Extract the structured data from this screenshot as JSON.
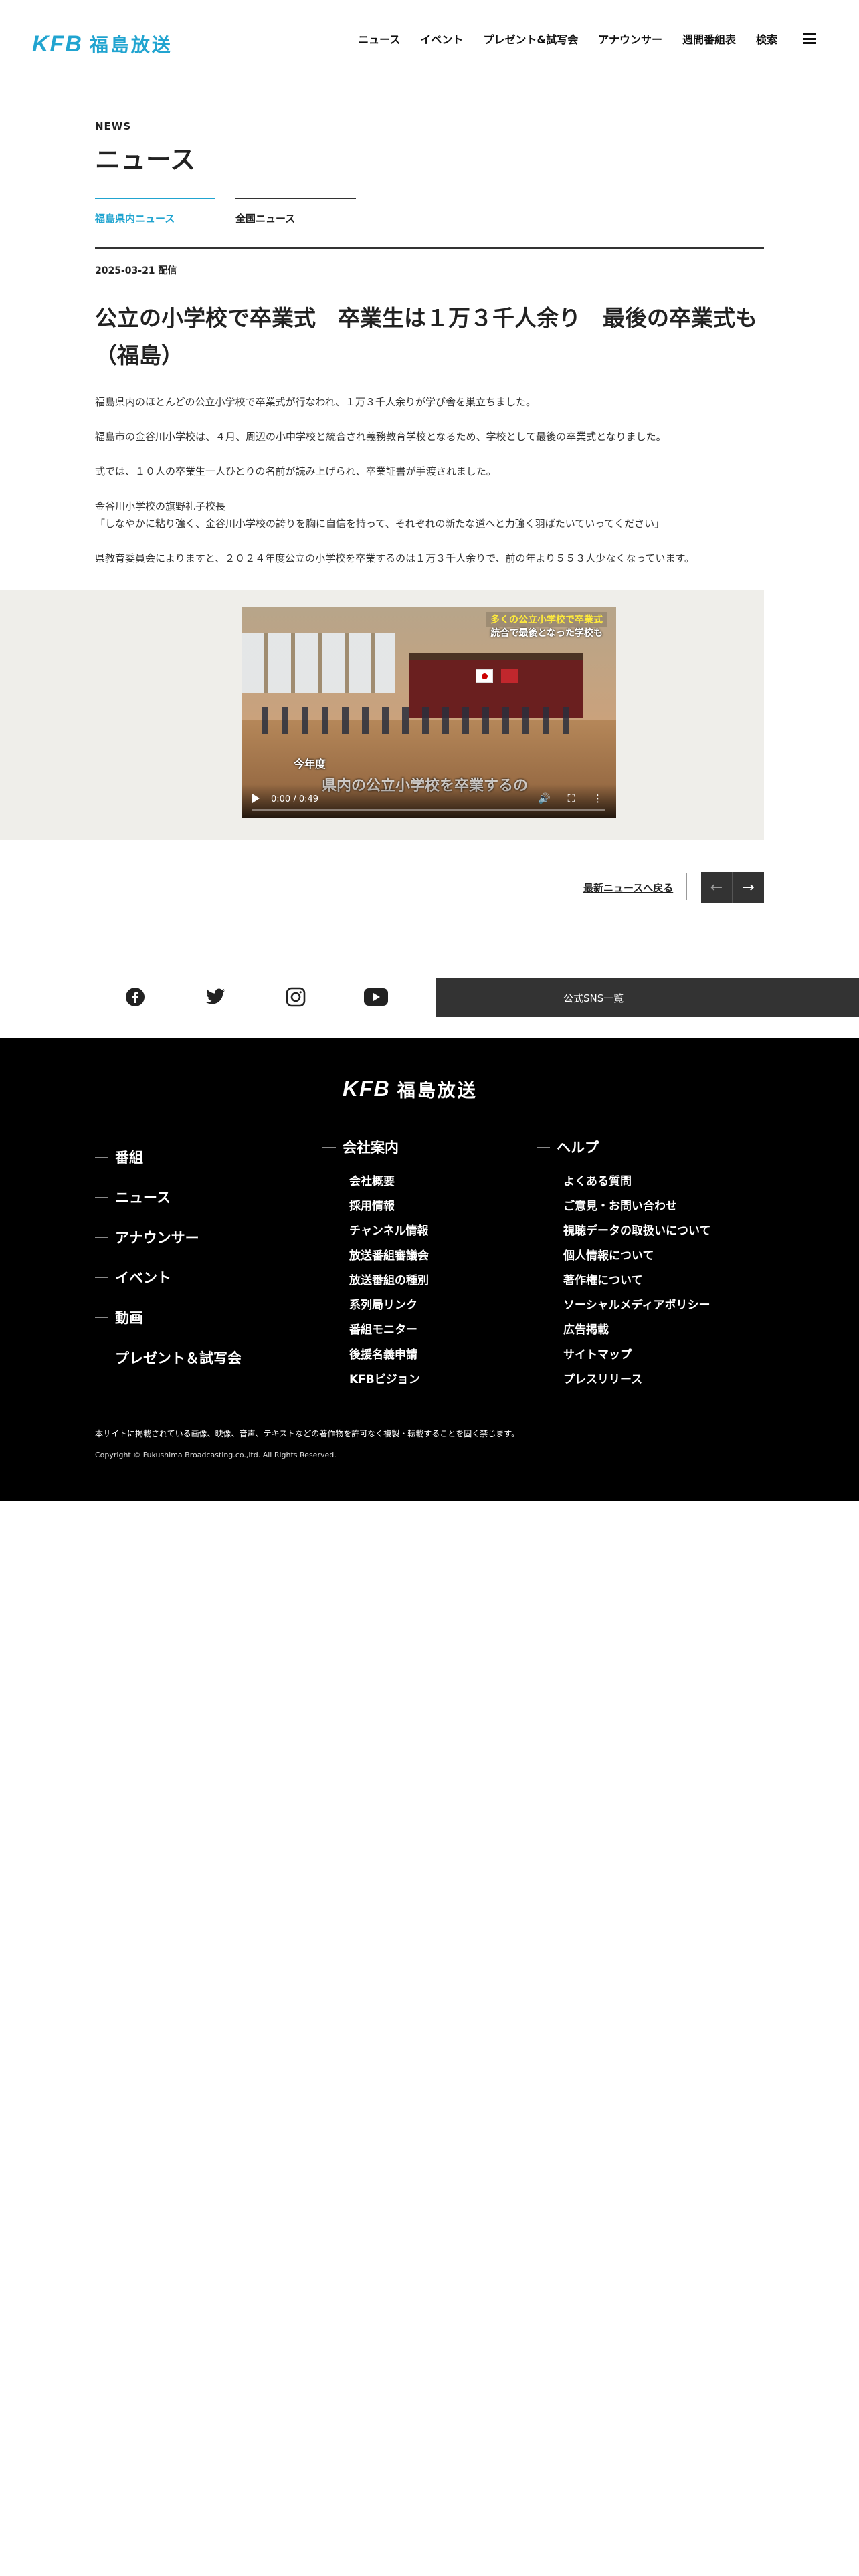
{
  "header": {
    "logo_mark": "KFB",
    "logo_text": "福島放送",
    "nav": [
      "ニュース",
      "イベント",
      "プレゼント&試写会",
      "アナウンサー",
      "週間番組表",
      "検索"
    ]
  },
  "page": {
    "eyebrow": "NEWS",
    "title": "ニュース",
    "tabs": [
      "福島県内ニュース",
      "全国ニュース"
    ]
  },
  "article": {
    "date": "2025-03-21 配信",
    "title": "公立の小学校で卒業式　卒業生は１万３千人余り　最後の卒業式も　（福島）",
    "paragraphs": [
      "福島県内のほとんどの公立小学校で卒業式が行なわれ、１万３千人余りが学び舎を巣立ちました。",
      "福島市の金谷川小学校は、４月、周辺の小中学校と統合され義務教育学校となるため、学校として最後の卒業式となりました。",
      "式では、１０人の卒業生一人ひとりの名前が読み上げられ、卒業証書が手渡されました。",
      "金谷川小学校の旗野礼子校長\n「しなやかに粘り強く、金谷川小学校の誇りを胸に自信を持って、それぞれの新たな道へと力強く羽ばたいていってください」",
      "県教育委員会によりますと、２０２４年度公立の小学校を卒業するのは１万３千人余りで、前の年より５５３人少なくなっています。"
    ]
  },
  "video": {
    "caption_top1": "多くの公立小学校で卒業式",
    "caption_top2": "統合で最後となった学校も",
    "caption_bottom1": "今年度",
    "caption_bottom2": "県内の公立小学校を卒業するの",
    "time": "0:00 / 0:49"
  },
  "pager": {
    "back_label": "最新ニュースへ戻る",
    "prev": "←",
    "next": "→"
  },
  "sns": {
    "icons": [
      "facebook-icon",
      "twitter-icon",
      "instagram-icon",
      "youtube-icon"
    ],
    "list_label": "公式SNS一覧"
  },
  "footer": {
    "logo_mark": "KFB",
    "logo_text": "福島放送",
    "col1": [
      "番組",
      "ニュース",
      "アナウンサー",
      "イベント",
      "動画",
      "プレゼント＆試写会"
    ],
    "col2_head": "会社案内",
    "col2": [
      "会社概要",
      "採用情報",
      "チャンネル情報",
      "放送番組審議会",
      "放送番組の種別",
      "系列局リンク",
      "番組モニター",
      "後援名義申請",
      "KFBビジョン"
    ],
    "col3_head": "ヘルプ",
    "col3": [
      "よくある質問",
      "ご意見・お問い合わせ",
      "視聴データの取扱いについて",
      "個人情報について",
      "著作権について",
      "ソーシャルメディアポリシー",
      "広告掲載",
      "サイトマップ",
      "プレスリリース"
    ],
    "note": "本サイトに掲載されている画像、映像、音声、テキストなどの著作物を許可なく複製・転載することを固く禁じます。",
    "copyright": "Copyright © Fukushima Broadcasting.co.,ltd. All Rights Reserved."
  }
}
